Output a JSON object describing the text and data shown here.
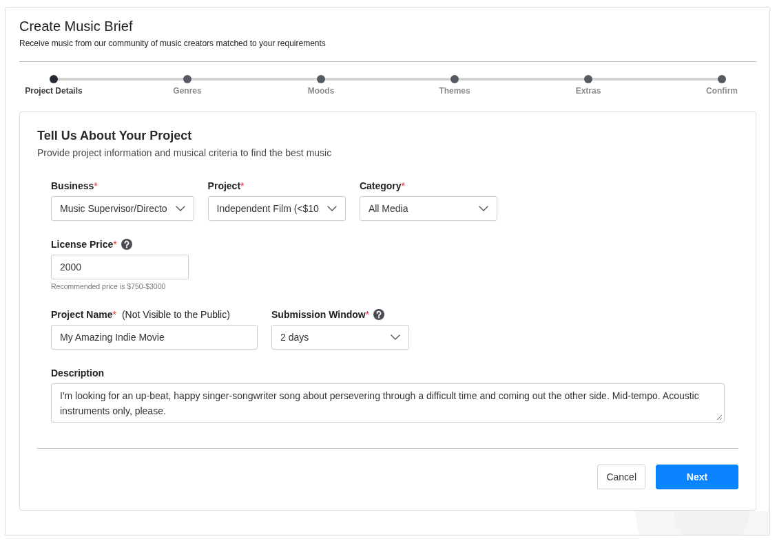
{
  "header": {
    "title": "Create Music Brief",
    "subtitle": "Receive music from our community of music creators matched to your requirements"
  },
  "steps": [
    {
      "label": "Project Details",
      "selected": true
    },
    {
      "label": "Genres",
      "selected": false
    },
    {
      "label": "Moods",
      "selected": false
    },
    {
      "label": "Themes",
      "selected": false
    },
    {
      "label": "Extras",
      "selected": false
    },
    {
      "label": "Confirm",
      "selected": false
    }
  ],
  "form": {
    "title": "Tell Us About Your Project",
    "subtitle": "Provide project information and musical criteria to find the best music",
    "rows": [
      [
        {
          "kind": "select",
          "label": "Business",
          "required_mark": "*",
          "value": "Music Supervisor/Directo"
        },
        {
          "kind": "select",
          "label": "Project",
          "required_mark": "*",
          "value": "Independent Film (<$10"
        },
        {
          "kind": "select",
          "label": "Category",
          "required_mark": "*",
          "value": "All Media"
        }
      ],
      [
        {
          "kind": "number",
          "label": "License Price",
          "required_mark": "*",
          "help": true,
          "value": "2000",
          "hint": "Recommended price is $750-$3000"
        }
      ],
      [
        {
          "kind": "text",
          "label": "Project Name",
          "required_mark": "*",
          "note": "(Not Visible to the Public)",
          "value": "My Amazing Indie Movie"
        },
        {
          "kind": "select",
          "label": "Submission Window",
          "required_mark": "*",
          "help": true,
          "value": "2 days"
        }
      ],
      [
        {
          "kind": "textarea",
          "label": "Description",
          "value": "I'm looking for an up-beat, happy singer-songwriter song about persevering through a difficult time and coming out the other side. Mid-tempo. Acoustic instruments only, please."
        }
      ]
    ],
    "buttons": [
      {
        "kind": "secondary",
        "label": "Cancel"
      },
      {
        "kind": "primary",
        "label": "Next"
      }
    ]
  }
}
